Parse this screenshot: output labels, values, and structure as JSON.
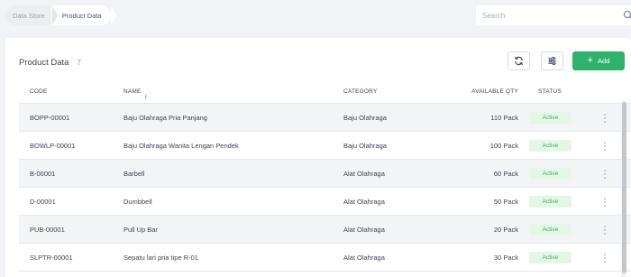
{
  "breadcrumb": {
    "items": [
      "Data Store",
      "Product Data"
    ]
  },
  "search": {
    "placeholder": "Search"
  },
  "header": {
    "title": "Product Data",
    "count": "7",
    "add_label": "Add"
  },
  "table": {
    "columns": {
      "code": "CODE",
      "name": "NAME",
      "category": "CATEGORY",
      "qty": "AVAILABLE QTY",
      "status": "STATUS"
    },
    "rows": [
      {
        "code": "BOPP-00001",
        "name": "Baju Olahraga Pria Panjang",
        "category": "Baju Olahraga",
        "qty": "110 Pack",
        "status": "Active"
      },
      {
        "code": "BOWLP-00001",
        "name": "Baju Olahraga Wanita Lengan Pendek",
        "category": "Baju Olahraga",
        "qty": "100 Pack",
        "status": "Active"
      },
      {
        "code": "B-00001",
        "name": "Barbell",
        "category": "Alat Olahraga",
        "qty": "60 Pack",
        "status": "Active"
      },
      {
        "code": "D-00001",
        "name": "Dumbbell",
        "category": "Alat Olahraga",
        "qty": "50 Pack",
        "status": "Active"
      },
      {
        "code": "PUB-00001",
        "name": "Pull Up Bar",
        "category": "Alat Olahraga",
        "qty": "20 Pack",
        "status": "Active"
      },
      {
        "code": "SLPTR-00001",
        "name": "Sepatu lari pria tipe R-01",
        "category": "Alat Olahraga",
        "qty": "30 Pack",
        "status": "Active"
      }
    ]
  },
  "icons": {
    "search": "search-icon",
    "refresh": "refresh-icon",
    "filter": "filter-icon",
    "add": "plus-icon",
    "sort": "sort-ascending-icon",
    "row_menu": "kebab-icon"
  },
  "colors": {
    "accent": "#2fb36b",
    "status_active_bg": "#e4f7e6",
    "status_active_text": "#3fae55",
    "background": "#f1f3f6"
  }
}
